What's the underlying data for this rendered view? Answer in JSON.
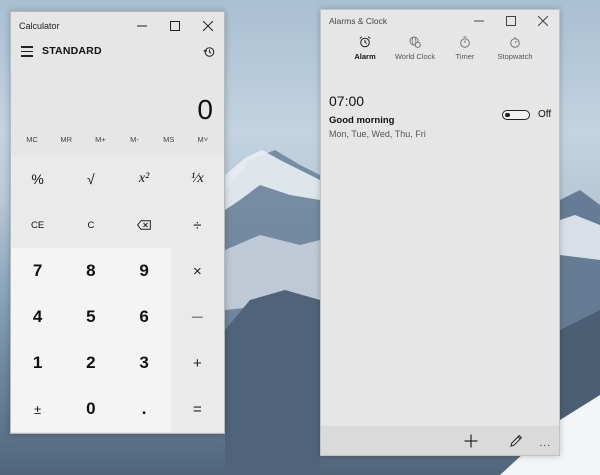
{
  "calculator": {
    "title": "Calculator",
    "mode": "STANDARD",
    "display": "0",
    "memory": [
      "MC",
      "MR",
      "M+",
      "M-",
      "MS",
      "M˅"
    ],
    "keys": [
      [
        "%",
        "√",
        "x²",
        "¹⁄x"
      ],
      [
        "CE",
        "C",
        "",
        "÷"
      ],
      [
        "7",
        "8",
        "9",
        "×"
      ],
      [
        "4",
        "5",
        "6",
        "—"
      ],
      [
        "1",
        "2",
        "3",
        "+"
      ],
      [
        "±",
        "0",
        ".",
        "="
      ]
    ]
  },
  "alarms": {
    "title": "Alarms & Clock",
    "tabs": [
      {
        "label": "Alarm",
        "icon": "alarm-icon",
        "active": true
      },
      {
        "label": "World Clock",
        "icon": "world-clock-icon",
        "active": false
      },
      {
        "label": "Timer",
        "icon": "timer-icon",
        "active": false
      },
      {
        "label": "Stopwatch",
        "icon": "stopwatch-icon",
        "active": false
      }
    ],
    "alarm": {
      "time": "07:00",
      "name": "Good morning",
      "days": "Mon, Tue, Wed, Thu, Fri",
      "toggle_state": "Off"
    },
    "bottom": {
      "more_label": "..."
    }
  }
}
